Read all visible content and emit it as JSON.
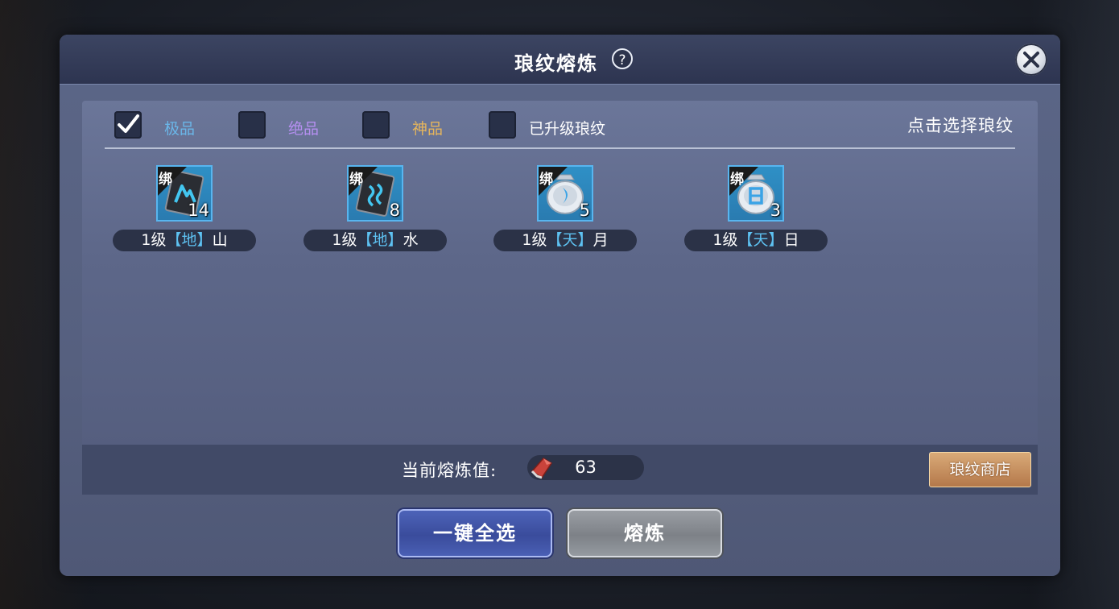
{
  "dialog": {
    "title": "琅纹熔炼",
    "help_symbol": "?",
    "close_icon": "close-icon"
  },
  "filters": [
    {
      "label": "极品",
      "checked": true,
      "color": "#6ab6e8"
    },
    {
      "label": "绝品",
      "checked": false,
      "color": "#b58ff0"
    },
    {
      "label": "神品",
      "checked": false,
      "color": "#e6b55c"
    },
    {
      "label": "已升级琅纹",
      "checked": false,
      "color": "#ffffff"
    }
  ],
  "hint": "点击选择琅纹",
  "items": [
    {
      "bind_tag": "绑",
      "count": "14",
      "level": "1级",
      "bracket_left": "【",
      "realm": "地",
      "bracket_right": "】",
      "name": "山",
      "icon": "mountain-rune-card-icon"
    },
    {
      "bind_tag": "绑",
      "count": "8",
      "level": "1级",
      "bracket_left": "【",
      "realm": "地",
      "bracket_right": "】",
      "name": "水",
      "icon": "water-rune-card-icon"
    },
    {
      "bind_tag": "绑",
      "count": "5",
      "level": "1级",
      "bracket_left": "【",
      "realm": "天",
      "bracket_right": "】",
      "name": "月",
      "icon": "moon-rune-stone-icon"
    },
    {
      "bind_tag": "绑",
      "count": "3",
      "level": "1级",
      "bracket_left": "【",
      "realm": "天",
      "bracket_right": "】",
      "name": "日",
      "icon": "sun-rune-stone-icon"
    }
  ],
  "footer": {
    "smelt_label": "当前熔炼值:",
    "smelt_value": "63",
    "shop_button": "琅纹商店"
  },
  "buttons": {
    "select_all": "一键全选",
    "smelt": "熔炼"
  },
  "colors": {
    "bracket": "#5ec2f2",
    "icon_frame": "#58b5ef"
  }
}
